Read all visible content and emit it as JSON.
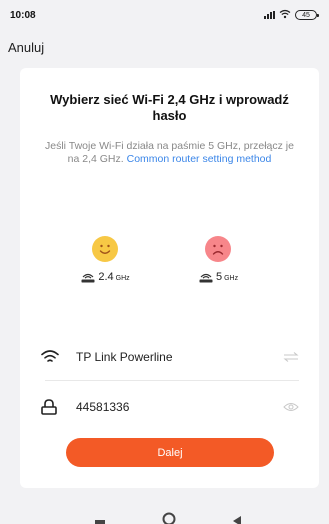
{
  "status_bar": {
    "time": "10:08",
    "battery": "45"
  },
  "header": {
    "cancel_label": "Anuluj"
  },
  "card": {
    "title": "Wybierz sieć Wi-Fi 2,4 GHz i wprowadź hasło",
    "description": "Jeśli Twoje Wi-Fi działa na paśmie 5 GHz, przełącz je na 2,4 GHz.",
    "help_link": "Common router setting method",
    "bands": [
      {
        "number": "2.4",
        "unit": "GHz",
        "face": "happy-face-icon",
        "color": "#f7c845"
      },
      {
        "number": "5",
        "unit": "GHz",
        "face": "sad-face-icon",
        "color": "#f7868a"
      }
    ],
    "wifi_name": "TP Link Powerline",
    "password": "44581336",
    "next_label": "Dalej"
  },
  "colors": {
    "accent": "#f35a26",
    "link": "#3b86e8",
    "background": "#f2f2f4"
  },
  "icons": {
    "wifi": "wifi-icon",
    "lock": "lock-icon",
    "switch": "switch-network-icon",
    "eye": "eye-icon",
    "router": "router-icon"
  }
}
